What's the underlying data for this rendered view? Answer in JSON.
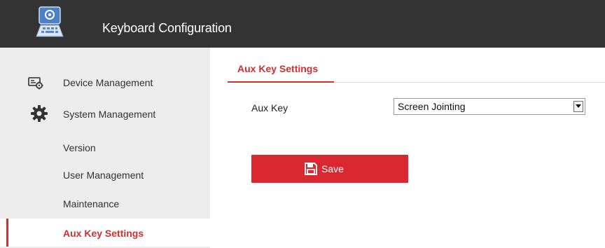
{
  "header": {
    "title": "Keyboard Configuration",
    "app_icon": "keyboard-app-icon"
  },
  "sidebar": {
    "items": [
      {
        "label": "Device Management",
        "icon": "device-management-icon",
        "level": 1
      },
      {
        "label": "System Management",
        "icon": "gear-icon",
        "level": 1
      },
      {
        "label": "Version",
        "level": 2
      },
      {
        "label": "User Management",
        "level": 2
      },
      {
        "label": "Maintenance",
        "level": 2
      },
      {
        "label": "Aux Key Settings",
        "level": 2,
        "active": true
      }
    ]
  },
  "main": {
    "tab_label": "Aux Key Settings",
    "aux_key": {
      "label": "Aux Key",
      "selected_value": "Screen Jointing"
    },
    "save_label": "Save"
  },
  "colors": {
    "header_bg": "#333333",
    "sidebar_bg": "#ececec",
    "accent": "#d32f2f",
    "button_bg": "#d9282f"
  }
}
